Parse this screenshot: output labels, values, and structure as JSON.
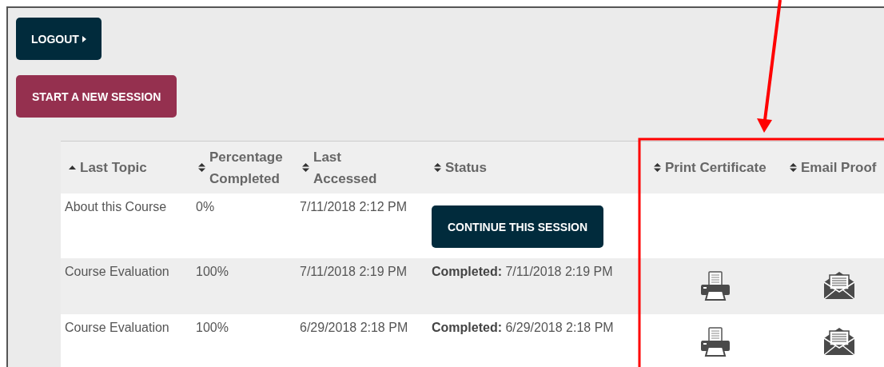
{
  "buttons": [
    {
      "label": "LOGOUT",
      "kind": "logout"
    },
    {
      "label": "START A NEW SESSION",
      "kind": "start"
    }
  ],
  "table": {
    "columns": [
      {
        "label": "Last Topic",
        "sorted_ascending": true
      },
      {
        "label": "Percentage Completed",
        "sorted_ascending": false
      },
      {
        "label": "Last Accessed",
        "sorted_ascending": false
      },
      {
        "label": "Status",
        "sorted_ascending": false
      },
      {
        "label": "Print Certificate",
        "sorted_ascending": false
      },
      {
        "label": "Email Proof",
        "sorted_ascending": false
      }
    ],
    "rows": [
      {
        "topic": "About this Course",
        "percent": "0%",
        "accessed": "7/11/2018 2:12 PM",
        "status": {
          "kind": "button",
          "text": "CONTINUE THIS SESSION"
        },
        "print": false,
        "email": false
      },
      {
        "topic": "Course Evaluation",
        "percent": "100%",
        "accessed": "7/11/2018 2:19 PM",
        "status": {
          "kind": "completed",
          "text": "**Completed:** 7/11/2018 2:19 PM"
        },
        "print": true,
        "email": true
      },
      {
        "topic": "Course Evaluation",
        "percent": "100%",
        "accessed": "6/29/2018 2:18 PM",
        "status": {
          "kind": "completed",
          "text": "**Completed:** 6/29/2018 2:18 PM"
        },
        "print": true,
        "email": true
      }
    ]
  },
  "annotation": {
    "kind": "arrow-and-frame"
  }
}
